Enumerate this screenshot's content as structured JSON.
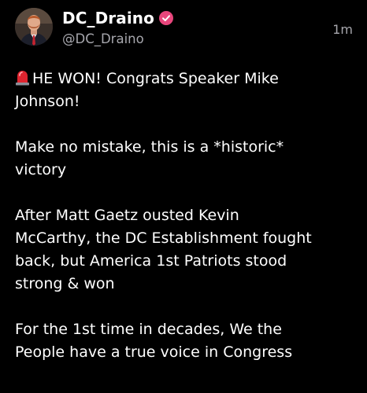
{
  "post": {
    "author": {
      "display_name": "DC_Draino",
      "handle": "@DC_Draino",
      "avatar_icon": "profile-photo",
      "verified_icon": "verified-badge-icon",
      "verified_color": "#e8467c"
    },
    "timestamp": "1m",
    "paragraphs": [
      {
        "lead_icon": "police-siren-icon",
        "lines": [
          "HE WON! Congrats Speaker Mike",
          "Johnson!"
        ]
      },
      {
        "lines": [
          "Make no mistake, this is a *historic*",
          "victory"
        ]
      },
      {
        "lines": [
          "After Matt Gaetz ousted Kevin",
          "McCarthy, the DC Establishment fought",
          "back, but America 1st Patriots stood",
          "strong & won"
        ]
      },
      {
        "lines": [
          "For the 1st time in decades, We the",
          "People have a true voice in Congress"
        ]
      }
    ]
  },
  "colors": {
    "background": "#000000",
    "text": "#ffffff",
    "muted": "#a7a7ad",
    "siren_red": "#e0242f"
  }
}
